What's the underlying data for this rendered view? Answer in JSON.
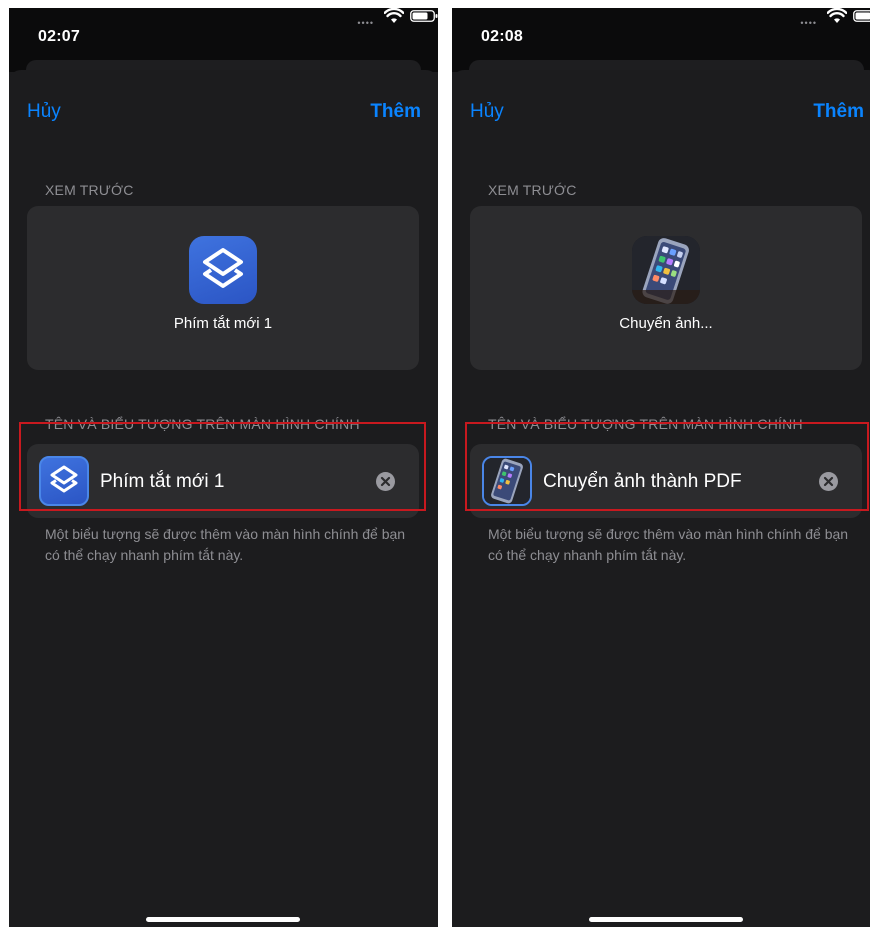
{
  "screens": [
    {
      "id": "left",
      "status_time": "02:07",
      "nav_cancel": "Hủy",
      "nav_add": "Thêm",
      "preview_header": "XEM TRƯỚC",
      "preview_name": "Phím tắt mới 1",
      "name_header": "TÊN VÀ BIỂU TƯỢNG TRÊN MÀN HÌNH CHÍNH",
      "name_value": "Phím tắt mới 1",
      "footer": "Một biểu tượng sẽ được thêm vào màn hình chính để bạn có thể chạy nhanh phím tắt này.",
      "icon": "shortcuts-app-icon"
    },
    {
      "id": "right",
      "status_time": "02:08",
      "nav_cancel": "Hủy",
      "nav_add": "Thêm",
      "preview_header": "XEM TRƯỚC",
      "preview_name": "Chuyển ảnh...",
      "name_header": "TÊN VÀ BIỂU TƯỢNG TRÊN MÀN HÌNH CHÍNH",
      "name_value": "Chuyển ảnh thành PDF",
      "footer": "Một biểu tượng sẽ được thêm vào màn hình chính để bạn có thể chạy nhanh phím tắt này.",
      "icon": "photo-thumbnail-icon"
    }
  ],
  "colors": {
    "background": "#1c1c1e",
    "card": "#2c2c2e",
    "accent": "#0a84ff",
    "highlight": "#c8191f",
    "secondary_text": "#8e8e93"
  }
}
